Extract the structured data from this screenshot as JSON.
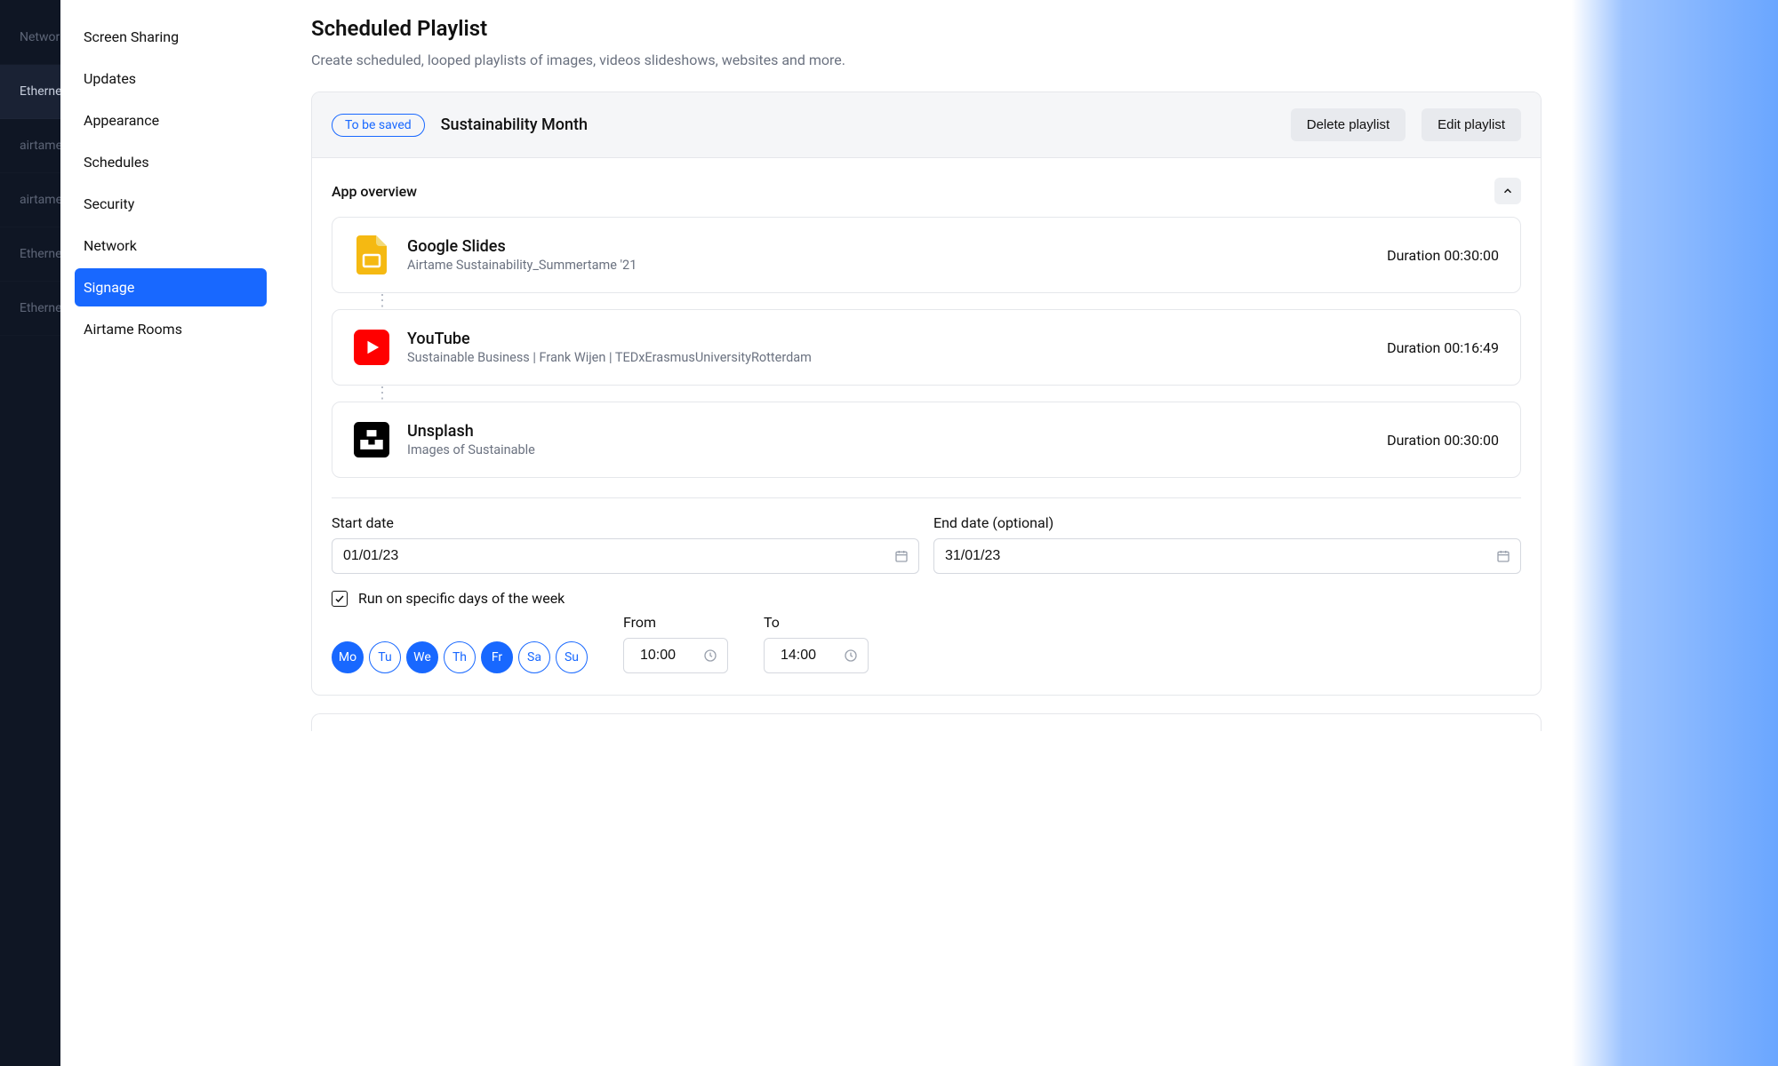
{
  "rail": {
    "items": [
      {
        "label": "Network"
      },
      {
        "label": "Ethernet",
        "active": true
      },
      {
        "label": "airtame"
      },
      {
        "label": "airtame"
      },
      {
        "label": "Ethernet"
      },
      {
        "label": "Ethernet"
      }
    ]
  },
  "sidebar": {
    "items": [
      {
        "label": "Screen Sharing"
      },
      {
        "label": "Updates"
      },
      {
        "label": "Appearance"
      },
      {
        "label": "Schedules"
      },
      {
        "label": "Security"
      },
      {
        "label": "Network"
      },
      {
        "label": "Signage",
        "active": true
      },
      {
        "label": "Airtame Rooms"
      }
    ]
  },
  "page": {
    "title": "Scheduled Playlist",
    "subtitle": "Create scheduled, looped playlists of images, videos slideshows, websites and more."
  },
  "playlist": {
    "badge": "To be saved",
    "name": "Sustainability Month",
    "delete_label": "Delete playlist",
    "edit_label": "Edit playlist",
    "section_label": "App overview",
    "items": [
      {
        "title": "Google Slides",
        "desc": "Airtame Sustainability_Summertame '21",
        "duration_label": "Duration 00:30:00",
        "icon": "google-slides"
      },
      {
        "title": "YouTube",
        "desc": "Sustainable Business | Frank Wijen | TEDxErasmusUniversityRotterdam",
        "duration_label": "Duration 00:16:49",
        "icon": "youtube"
      },
      {
        "title": "Unsplash",
        "desc": "Images of Sustainable",
        "duration_label": "Duration 00:30:00",
        "icon": "unsplash"
      }
    ],
    "dates": {
      "start_label": "Start date",
      "start_value": "01/01/23",
      "end_label": "End date (optional)",
      "end_value": "31/01/23"
    },
    "days": {
      "checkbox_label": "Run on specific days of the week",
      "list": [
        {
          "abbr": "Mo",
          "on": true
        },
        {
          "abbr": "Tu",
          "on": false
        },
        {
          "abbr": "We",
          "on": true
        },
        {
          "abbr": "Th",
          "on": false
        },
        {
          "abbr": "Fr",
          "on": true
        },
        {
          "abbr": "Sa",
          "on": false
        },
        {
          "abbr": "Su",
          "on": false
        }
      ]
    },
    "time": {
      "from_label": "From",
      "from_value": "10:00",
      "to_label": "To",
      "to_value": "14:00"
    }
  }
}
